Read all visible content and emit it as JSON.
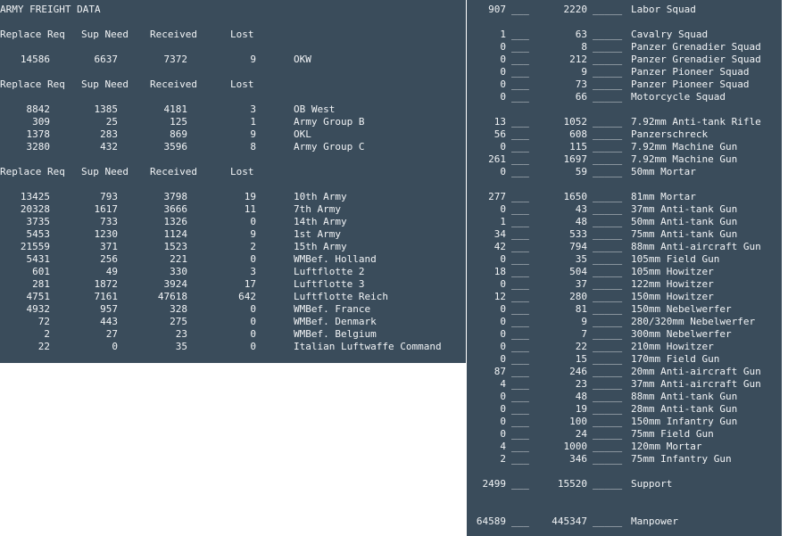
{
  "title": "ARMY FREIGHT DATA",
  "headers": {
    "replace_req": "Replace Req",
    "sup_need": "Sup Need",
    "received": "Received",
    "lost": "Lost"
  },
  "left_sections": [
    {
      "rows": [
        {
          "replace_req": "14586",
          "sup_need": "6637",
          "received": "7372",
          "lost": "9",
          "name": "OKW"
        }
      ]
    },
    {
      "rows": [
        {
          "replace_req": "8842",
          "sup_need": "1385",
          "received": "4181",
          "lost": "3",
          "name": "OB West"
        },
        {
          "replace_req": "309",
          "sup_need": "25",
          "received": "125",
          "lost": "1",
          "name": "Army Group B"
        },
        {
          "replace_req": "1378",
          "sup_need": "283",
          "received": "869",
          "lost": "9",
          "name": "OKL"
        },
        {
          "replace_req": "3280",
          "sup_need": "432",
          "received": "3596",
          "lost": "8",
          "name": "Army Group C"
        }
      ]
    },
    {
      "rows": [
        {
          "replace_req": "13425",
          "sup_need": "793",
          "received": "3798",
          "lost": "19",
          "name": "10th Army"
        },
        {
          "replace_req": "20328",
          "sup_need": "1617",
          "received": "3666",
          "lost": "11",
          "name": "7th Army"
        },
        {
          "replace_req": "3735",
          "sup_need": "733",
          "received": "1326",
          "lost": "0",
          "name": "14th Army"
        },
        {
          "replace_req": "5453",
          "sup_need": "1230",
          "received": "1124",
          "lost": "9",
          "name": "1st Army"
        },
        {
          "replace_req": "21559",
          "sup_need": "371",
          "received": "1523",
          "lost": "2",
          "name": "15th Army"
        },
        {
          "replace_req": "5431",
          "sup_need": "256",
          "received": "221",
          "lost": "0",
          "name": "WMBef. Holland"
        },
        {
          "replace_req": "601",
          "sup_need": "49",
          "received": "330",
          "lost": "3",
          "name": "Luftflotte 2"
        },
        {
          "replace_req": "281",
          "sup_need": "1872",
          "received": "3924",
          "lost": "17",
          "name": "Luftflotte 3"
        },
        {
          "replace_req": "4751",
          "sup_need": "7161",
          "received": "47618",
          "lost": "642",
          "name": "Luftflotte Reich"
        },
        {
          "replace_req": "4932",
          "sup_need": "957",
          "received": "328",
          "lost": "0",
          "name": "WMBef. France"
        },
        {
          "replace_req": "72",
          "sup_need": "443",
          "received": "275",
          "lost": "0",
          "name": "WMBef. Denmark"
        },
        {
          "replace_req": "2",
          "sup_need": "27",
          "received": "23",
          "lost": "0",
          "name": "WMBef. Belgium"
        },
        {
          "replace_req": "22",
          "sup_need": "0",
          "received": "35",
          "lost": "0",
          "name": "Italian Luftwaffe Command"
        }
      ]
    }
  ],
  "right_groups": [
    {
      "items": [
        {
          "a": "907",
          "b": "2220",
          "name": "Labor Squad"
        }
      ]
    },
    {
      "items": [
        {
          "a": "1",
          "b": "63",
          "name": "Cavalry Squad"
        },
        {
          "a": "0",
          "b": "8",
          "name": "Panzer Grenadier Squad"
        },
        {
          "a": "0",
          "b": "212",
          "name": "Panzer Grenadier Squad"
        },
        {
          "a": "0",
          "b": "9",
          "name": "Panzer Pioneer Squad"
        },
        {
          "a": "0",
          "b": "73",
          "name": "Panzer Pioneer Squad"
        },
        {
          "a": "0",
          "b": "66",
          "name": "Motorcycle Squad"
        }
      ]
    },
    {
      "items": [
        {
          "a": "13",
          "b": "1052",
          "name": "7.92mm Anti-tank Rifle"
        },
        {
          "a": "56",
          "b": "608",
          "name": "Panzerschreck"
        },
        {
          "a": "0",
          "b": "115",
          "name": "7.92mm Machine Gun"
        },
        {
          "a": "261",
          "b": "1697",
          "name": "7.92mm Machine Gun"
        },
        {
          "a": "0",
          "b": "59",
          "name": "50mm Mortar"
        }
      ]
    },
    {
      "items": [
        {
          "a": "277",
          "b": "1650",
          "name": "81mm Mortar"
        },
        {
          "a": "0",
          "b": "43",
          "name": "37mm Anti-tank Gun"
        },
        {
          "a": "1",
          "b": "48",
          "name": "50mm Anti-tank Gun"
        },
        {
          "a": "34",
          "b": "533",
          "name": "75mm Anti-tank Gun"
        },
        {
          "a": "42",
          "b": "794",
          "name": "88mm Anti-aircraft Gun"
        },
        {
          "a": "0",
          "b": "35",
          "name": "105mm Field Gun"
        },
        {
          "a": "18",
          "b": "504",
          "name": "105mm Howitzer"
        },
        {
          "a": "0",
          "b": "37",
          "name": "122mm Howitzer"
        },
        {
          "a": "12",
          "b": "280",
          "name": "150mm Howitzer"
        },
        {
          "a": "0",
          "b": "81",
          "name": "150mm Nebelwerfer"
        },
        {
          "a": "0",
          "b": "9",
          "name": "280/320mm Nebelwerfer"
        },
        {
          "a": "0",
          "b": "7",
          "name": "300mm Nebelwerfer"
        },
        {
          "a": "0",
          "b": "22",
          "name": "210mm Howitzer"
        },
        {
          "a": "0",
          "b": "15",
          "name": "170mm Field Gun"
        },
        {
          "a": "87",
          "b": "246",
          "name": "20mm Anti-aircraft Gun"
        },
        {
          "a": "4",
          "b": "23",
          "name": "37mm Anti-aircraft Gun"
        },
        {
          "a": "0",
          "b": "48",
          "name": "88mm Anti-tank Gun"
        },
        {
          "a": "0",
          "b": "19",
          "name": "28mm Anti-tank Gun"
        },
        {
          "a": "0",
          "b": "100",
          "name": "150mm Infantry Gun"
        },
        {
          "a": "0",
          "b": "24",
          "name": "75mm Field Gun"
        },
        {
          "a": "4",
          "b": "1000",
          "name": "120mm Mortar"
        },
        {
          "a": "2",
          "b": "346",
          "name": "75mm Infantry Gun"
        }
      ]
    },
    {
      "items": [
        {
          "a": "2499",
          "b": "15520",
          "name": "Support"
        }
      ]
    },
    {
      "items": [
        {
          "a": "64589",
          "b": "445347",
          "name": "Manpower"
        }
      ]
    }
  ],
  "separators": {
    "short": "___",
    "long": "_____"
  },
  "colors": {
    "panel": "#3a4c5b",
    "text": "#f2f4f6",
    "background": "#ffffff"
  }
}
